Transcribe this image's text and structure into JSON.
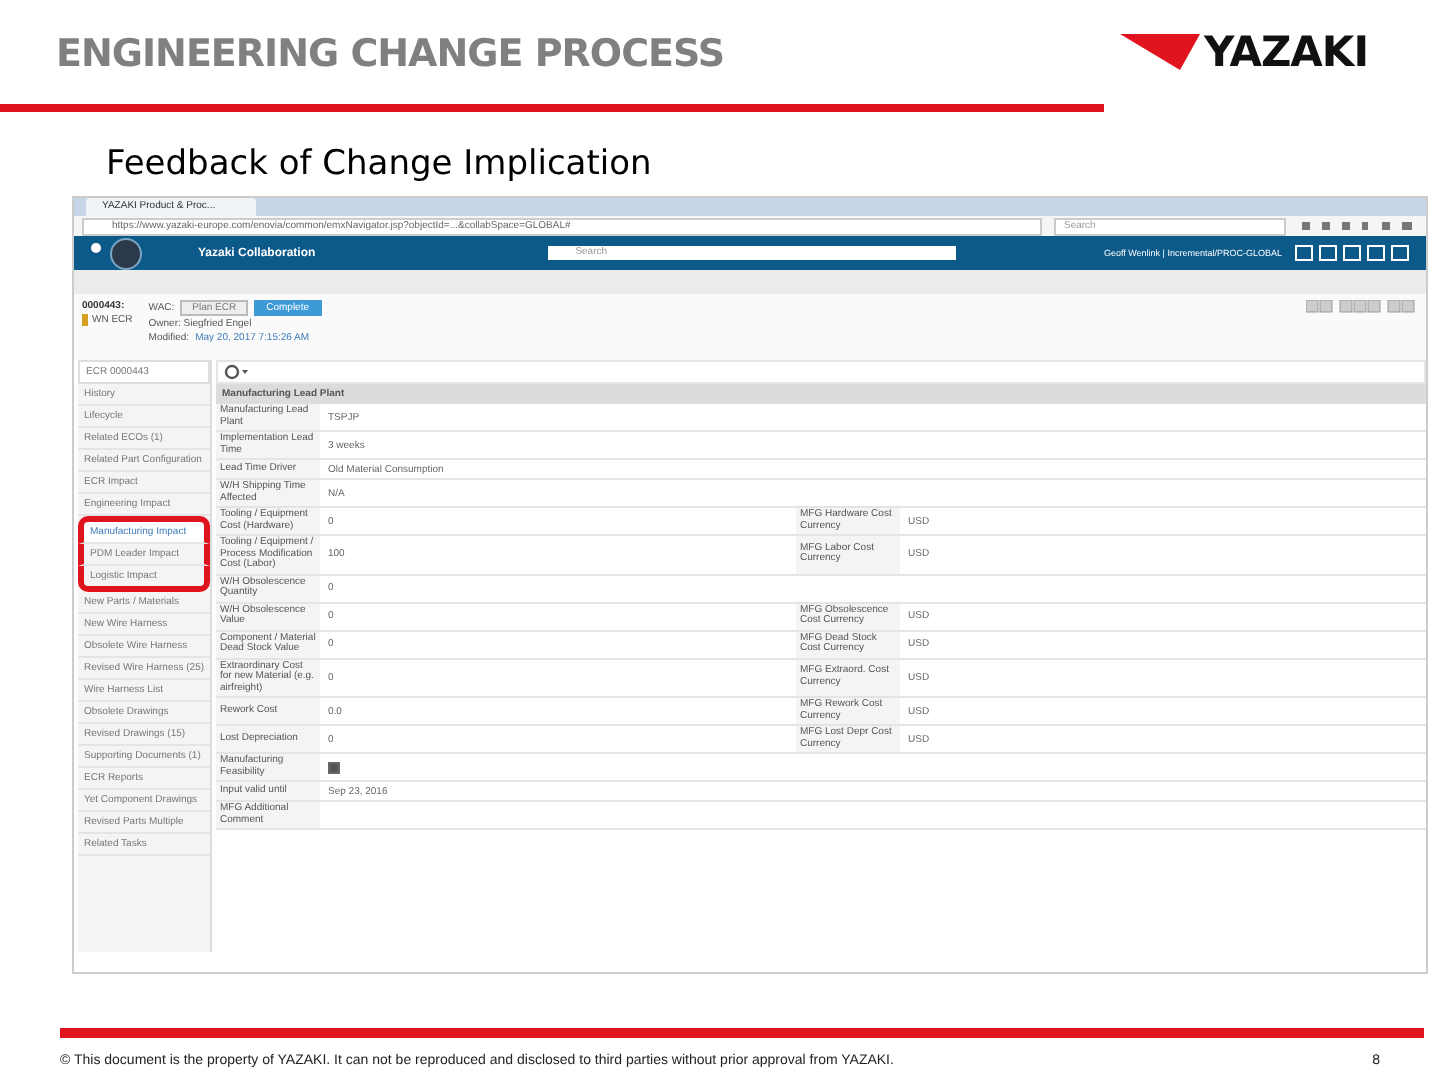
{
  "slide": {
    "title": "ENGINEERING CHANGE PROCESS",
    "brand": "YAZAKI",
    "subtitle": "Feedback of Change Implication",
    "footer": "© This document is the property of YAZAKI. It can not be reproduced and disclosed to third parties without prior approval from YAZAKI.",
    "page": "8"
  },
  "browser": {
    "tab": "YAZAKI Product & Proc...",
    "address": "https://www.yazaki-europe.com/enovia/common/emxNavigator.jsp?objectId=...&collabSpace=GLOBAL#",
    "search_placeholder": "Search"
  },
  "app": {
    "title": "Yazaki Collaboration",
    "search_placeholder": "Search",
    "user": "Geoff Wenlink | Incremental/PROC-GLOBAL"
  },
  "object": {
    "id": "0000443:",
    "type": "WN ECR",
    "state_label": "WAC:",
    "buttons": [
      {
        "label": "Plan ECR",
        "selected": false
      },
      {
        "label": "Complete",
        "selected": true
      }
    ],
    "owner": "Owner: Siegfried Engel",
    "modified_label": "Modified:",
    "modified": "May 20, 2017 7:15:26 AM"
  },
  "sidebar": {
    "header": "ECR 0000443",
    "items": [
      {
        "label": "History",
        "selected": false,
        "highlighted": false
      },
      {
        "label": "Lifecycle",
        "selected": false,
        "highlighted": false
      },
      {
        "label": "Related ECOs (1)",
        "selected": false,
        "highlighted": false
      },
      {
        "label": "Related Part Configuration",
        "selected": false,
        "highlighted": false
      },
      {
        "label": "ECR Impact",
        "selected": false,
        "highlighted": false
      },
      {
        "label": "Engineering Impact",
        "selected": false,
        "highlighted": false
      },
      {
        "label": "Manufacturing Impact",
        "selected": true,
        "highlighted": true
      },
      {
        "label": "PDM Leader Impact",
        "selected": false,
        "highlighted": true
      },
      {
        "label": "Logistic Impact",
        "selected": false,
        "highlighted": true
      },
      {
        "label": "New Parts / Materials",
        "selected": false,
        "highlighted": false
      },
      {
        "label": "New Wire Harness",
        "selected": false,
        "highlighted": false
      },
      {
        "label": "Obsolete Wire Harness",
        "selected": false,
        "highlighted": false
      },
      {
        "label": "Revised Wire Harness (25)",
        "selected": false,
        "highlighted": false
      },
      {
        "label": "Wire Harness List",
        "selected": false,
        "highlighted": false
      },
      {
        "label": "Obsolete Drawings",
        "selected": false,
        "highlighted": false
      },
      {
        "label": "Revised Drawings (15)",
        "selected": false,
        "highlighted": false
      },
      {
        "label": "Supporting Documents (1)",
        "selected": false,
        "highlighted": false
      },
      {
        "label": "ECR Reports",
        "selected": false,
        "highlighted": false
      },
      {
        "label": "Yet Component Drawings",
        "selected": false,
        "highlighted": false
      },
      {
        "label": "Revised Parts Multiple",
        "selected": false,
        "highlighted": false
      },
      {
        "label": "Related Tasks",
        "selected": false,
        "highlighted": false
      }
    ]
  },
  "section_title": "Manufacturing Lead Plant",
  "rows": [
    {
      "kind": "text",
      "label": "Manufacturing Lead Plant",
      "value": "TSPJP"
    },
    {
      "kind": "text",
      "label": "Implementation Lead Time",
      "value": "3 weeks"
    },
    {
      "kind": "text",
      "label": "Lead Time Driver",
      "value": "Old Material Consumption"
    },
    {
      "kind": "text",
      "label": "W/H Shipping Time Affected",
      "value": "N/A"
    },
    {
      "kind": "text",
      "label": "Tooling / Equipment Cost (Hardware)",
      "value": "0",
      "label_2": "MFG Hardware Cost Currency",
      "value_2": "USD"
    },
    {
      "kind": "text",
      "label": "Tooling / Equipment / Process Modification Cost (Labor)",
      "value": "100",
      "label_2": "MFG Labor Cost Currency",
      "value_2": "USD"
    },
    {
      "kind": "text",
      "label": "W/H Obsolescence Quantity",
      "value": "0"
    },
    {
      "kind": "text",
      "label": "W/H Obsolescence Value",
      "value": "0",
      "label_2": "MFG Obsolescence Cost Currency",
      "value_2": "USD"
    },
    {
      "kind": "text",
      "label": "Component / Material Dead Stock Value",
      "value": "0",
      "label_2": "MFG Dead Stock Cost Currency",
      "value_2": "USD"
    },
    {
      "kind": "text",
      "label": "Extraordinary Cost for new Material (e.g. airfreight)",
      "value": "0",
      "label_2": "MFG Extraord. Cost Currency",
      "value_2": "USD"
    },
    {
      "kind": "text",
      "label": "Rework Cost",
      "value": "0.0",
      "label_2": "MFG Rework Cost Currency",
      "value_2": "USD"
    },
    {
      "kind": "text",
      "label": "Lost Depreciation",
      "value": "0",
      "label_2": "MFG Lost Depr Cost Currency",
      "value_2": "USD"
    },
    {
      "kind": "checkbox",
      "label": "Manufacturing Feasibility",
      "checked": true
    },
    {
      "kind": "text",
      "label": "Input valid until",
      "value": "Sep 23, 2016"
    },
    {
      "kind": "text",
      "label": "MFG Additional Comment"
    }
  ]
}
